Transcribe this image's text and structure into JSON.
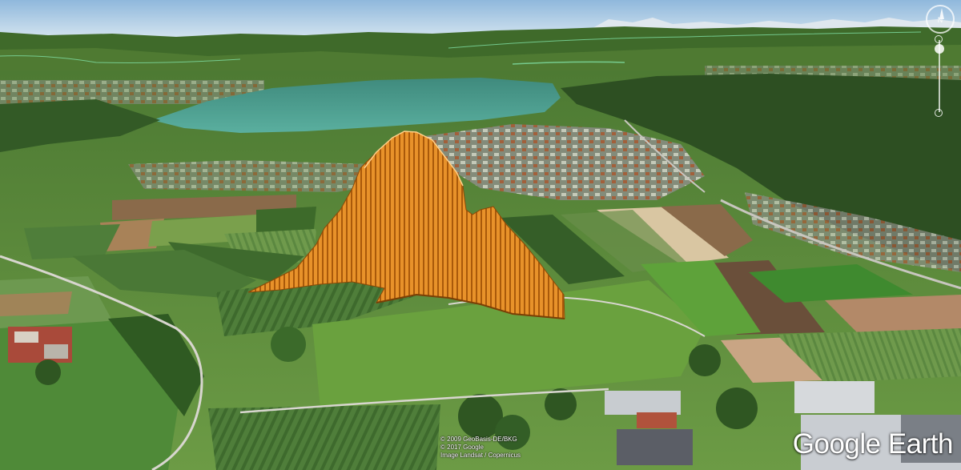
{
  "app": {
    "logo_text": "Google Earth",
    "attribution": [
      "© 2009 GeoBasis-DE/BKG",
      "© 2017 Google",
      "Image Landsat / Copernicus"
    ]
  },
  "controls": {
    "compass_letter": "N",
    "zoom_level_fraction": 0.12
  },
  "scene": {
    "sky_top_color": "#bcd8ef",
    "lake_color": "#4a9e92",
    "overlay_color": "#f0a030",
    "overlay_dark_color": "#b86a10",
    "terrain_colors": [
      "#5e8c3a",
      "#466f2a",
      "#7fa24e",
      "#8c7a56",
      "#3f6b2e"
    ],
    "overlay_description_hidden": ""
  }
}
